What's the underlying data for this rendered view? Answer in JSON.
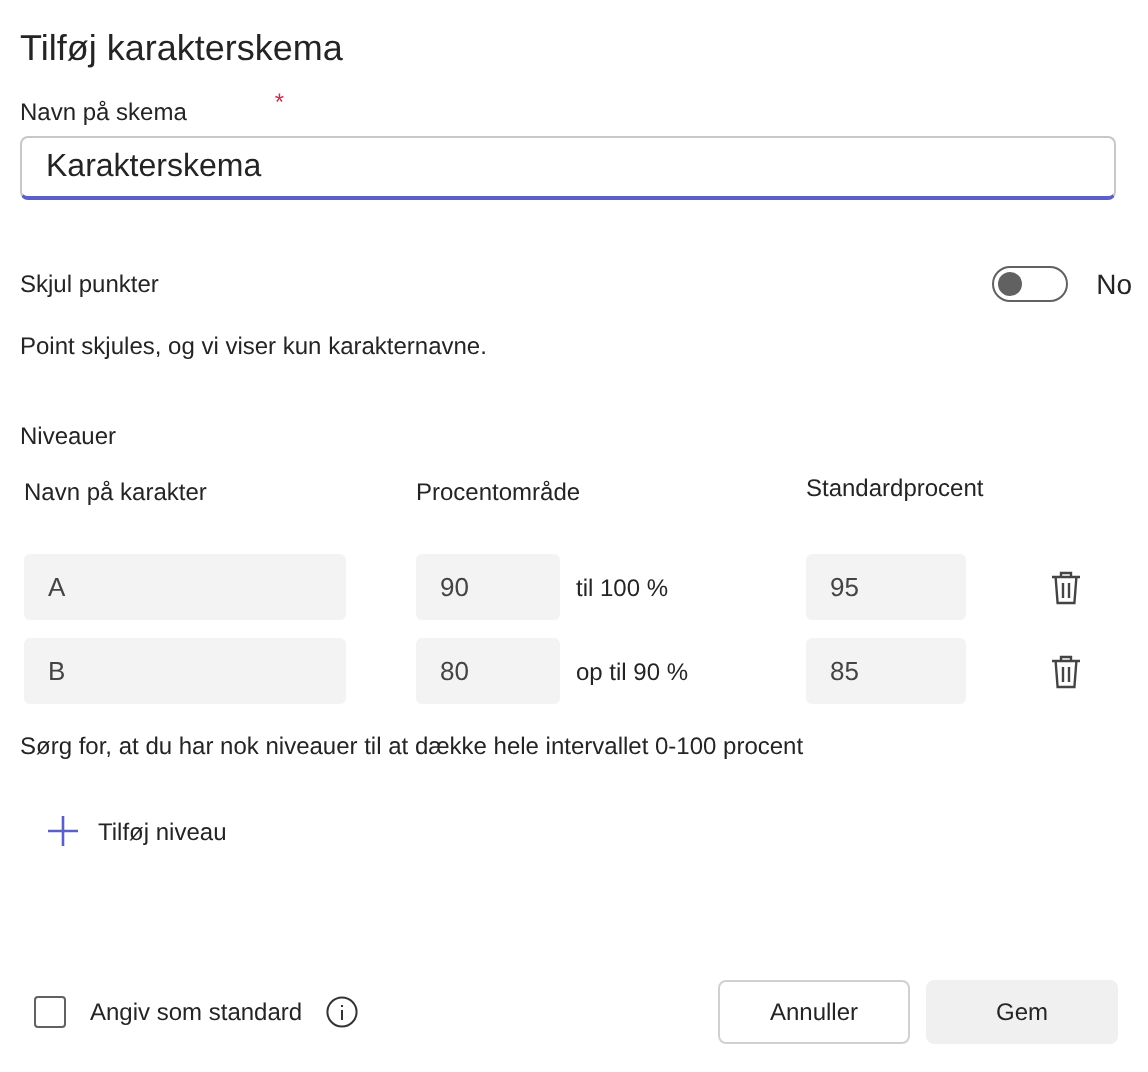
{
  "dialog": {
    "title": "Tilføj karakterskema"
  },
  "name_field": {
    "label": "Navn på skema",
    "required_mark": "*",
    "value": "Karakterskema"
  },
  "hide_points": {
    "label": "Skjul punkter",
    "on": false,
    "state_text": "No",
    "help": "Point skjules, og vi viser kun karakternavne."
  },
  "levels": {
    "title": "Niveauer",
    "columns": [
      "Navn på karakter",
      "Procentområde",
      "Standardprocent"
    ],
    "rows": [
      {
        "name": "A",
        "min": "90",
        "range_text": "til 100 %",
        "default": "95"
      },
      {
        "name": "B",
        "min": "80",
        "range_text": "op til 90 %",
        "default": "85"
      }
    ],
    "warning": "Sørg for, at du har nok niveauer til at dække hele intervallet 0-100 procent",
    "add_label": "Tilføj niveau"
  },
  "footer": {
    "default_checkbox": {
      "label": "Angiv som standard",
      "checked": false
    },
    "buttons": [
      {
        "label": "Annuller",
        "kind": "secondary"
      },
      {
        "label": "Gem",
        "kind": "primary"
      }
    ]
  }
}
